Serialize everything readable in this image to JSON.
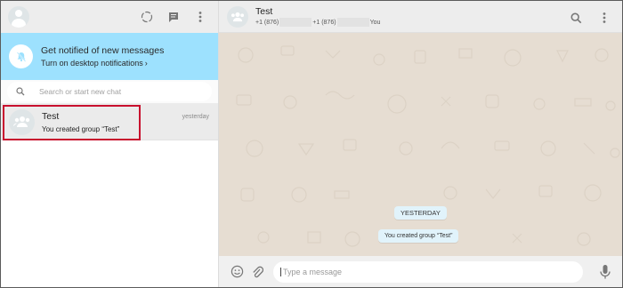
{
  "left_header": {
    "icons": [
      "status-icon",
      "new-chat-icon",
      "menu-icon"
    ]
  },
  "notification": {
    "title": "Get notified of new messages",
    "subtitle": "Turn on desktop notifications",
    "chevron": "›"
  },
  "search": {
    "placeholder": "Search or start new chat"
  },
  "chats": [
    {
      "name": "Test",
      "preview": "You created group “Test”",
      "time": "yesterday"
    }
  ],
  "conversation": {
    "title": "Test",
    "member_1_prefix": "+1 (876)",
    "member_2_prefix": "+1 (876)",
    "you": "You",
    "day_label": "YESTERDAY",
    "system_message": "You created group “Test”"
  },
  "composer": {
    "placeholder": "Type a message"
  },
  "colors": {
    "notification_bg": "#9de1fe",
    "header_bg": "#ededed",
    "wallpaper": "#e6ddd2",
    "highlight": "#c8102e",
    "bubble": "#e1f3fb"
  }
}
